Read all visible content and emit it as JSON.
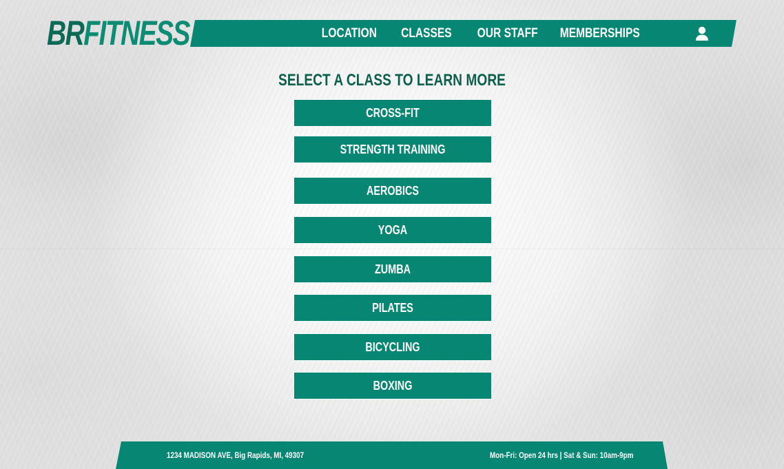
{
  "brand": {
    "logo_part1": "BR",
    "logo_part2": "FITNESS",
    "primary_color": "#078674",
    "dark_color": "#0a6a55",
    "title_color": "#0d5f4c"
  },
  "nav": {
    "items": [
      {
        "label": "LOCATION"
      },
      {
        "label": "CLASSES"
      },
      {
        "label": "OUR STAFF"
      },
      {
        "label": "MEMBERSHIPS"
      }
    ],
    "account_icon": "user-icon"
  },
  "main": {
    "title": "SELECT A CLASS TO LEARN MORE",
    "classes": [
      {
        "label": "CROSS-FIT"
      },
      {
        "label": "STRENGTH TRAINING"
      },
      {
        "label": "AEROBICS"
      },
      {
        "label": "YOGA"
      },
      {
        "label": "ZUMBA"
      },
      {
        "label": "PILATES"
      },
      {
        "label": "BICYCLING"
      },
      {
        "label": "BOXING"
      }
    ]
  },
  "footer": {
    "address": "1234 MADISON AVE, Big Rapids, MI, 49307",
    "hours": "Mon-Fri: Open 24 hrs | Sat & Sun: 10am-9pm"
  }
}
